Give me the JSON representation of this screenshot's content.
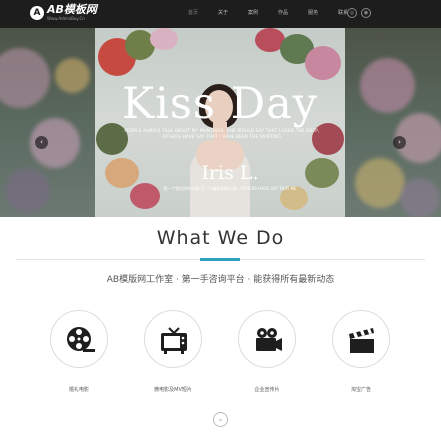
{
  "header": {
    "logo_text": "AB模板网",
    "logo_sub": "Www.AdminBuy.Cn",
    "logo_mark": "A",
    "nav": [
      "首页",
      "关于",
      "案例",
      "作品",
      "服务",
      "联系"
    ],
    "active_nav": 0,
    "icons": [
      "weibo-icon",
      "wechat-icon"
    ],
    "icon_glyphs": [
      "◎",
      "◉"
    ]
  },
  "hero": {
    "title": "Kiss Day",
    "tagline": "PEOPLE ALWAYS TALK ABOUT MY PAINTINGS. SHE WOULD SAY THAT I USED THE DEEP, OTHERS HAVE SAY THAT I HAVE BEEN THE PAINTING",
    "name": "Iris L.",
    "subtitle": "第一个我们的Kiss剧 又一个精彩的Kiss剧，OTHERS HAVE SAY THAT ME",
    "prev_glyph": "‹",
    "next_glyph": "›"
  },
  "section": {
    "title": "What We Do",
    "subtitle": "AB模版网工作室 · 第一手咨询平台 · 能获得所有最新动态",
    "accent_color": "#2ea3c0"
  },
  "services": [
    {
      "label": "婚礼电影",
      "icon": "film-reel-icon"
    },
    {
      "label": "微电影及MV短片",
      "icon": "tv-icon"
    },
    {
      "label": "企业宣传片",
      "icon": "video-camera-icon"
    },
    {
      "label": "淘宝广告",
      "icon": "clapperboard-icon"
    }
  ],
  "scroll_glyph": "⌄"
}
